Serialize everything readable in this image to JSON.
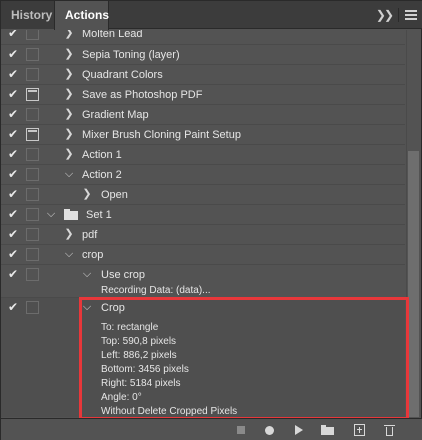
{
  "tabs": {
    "history": "History",
    "actions": "Actions"
  },
  "header_icons": [
    "collapse-icon",
    "panel-menu-icon"
  ],
  "rows": {
    "molten_lead": "Molten Lead",
    "sepia": "Sepia Toning (layer)",
    "quadrant": "Quadrant Colors",
    "save_pdf": "Save as Photoshop PDF",
    "gradient": "Gradient Map",
    "mixer": "Mixer Brush Cloning Paint Setup",
    "action1": "Action 1",
    "action2": "Action 2",
    "open": "Open",
    "set1": "Set 1",
    "pdf": "pdf",
    "crop_action": "crop",
    "use_crop": "Use crop",
    "recording_data": "Recording Data: (data)...",
    "crop_step": "Crop"
  },
  "crop_details": {
    "to": "To: rectangle",
    "top": "Top: 590,8 pixels",
    "left": "Left: 886,2 pixels",
    "bottom": "Bottom: 3456 pixels",
    "right": "Right: 5184 pixels",
    "angle": "Angle: 0°",
    "delete": "Without Delete Cropped Pixels"
  },
  "toolbar_icons": [
    "stop-icon",
    "record-icon",
    "play-icon",
    "new-set-icon",
    "new-action-icon",
    "trash-icon"
  ],
  "colors": {
    "panel_bg": "#535353",
    "highlight": "#e8373a"
  }
}
